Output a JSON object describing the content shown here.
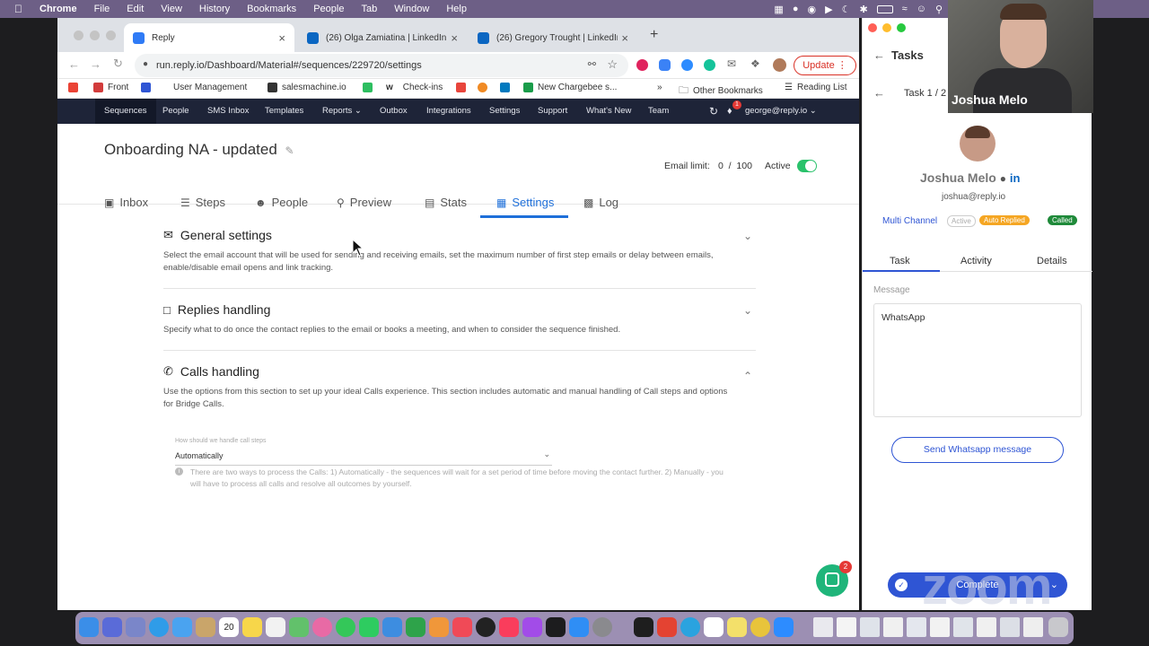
{
  "menubar": {
    "items": [
      "Chrome",
      "File",
      "Edit",
      "View",
      "History",
      "Bookmarks",
      "People",
      "Tab",
      "Window",
      "Help"
    ]
  },
  "browser": {
    "tabs": [
      {
        "title": "Reply",
        "color": "#2f7bf6"
      },
      {
        "title": "(26) Olga Zamiatina | LinkedIn",
        "color": "#0a66c2"
      },
      {
        "title": "(26) Gregory Trought | LinkedIn",
        "color": "#0a66c2"
      }
    ],
    "new_tab": "+",
    "url": "run.reply.io/Dashboard/Material#/sequences/229720/settings",
    "update_label": "Update",
    "bookmarks": [
      "Front",
      "User Management",
      "salesmachine.io",
      "Check-ins",
      "New Chargebee s...",
      "Other Bookmarks",
      "Reading List"
    ],
    "bookmarks_more": "»"
  },
  "appnav": {
    "items": [
      "Sequences",
      "People",
      "SMS Inbox",
      "Templates",
      "Reports",
      "Outbox",
      "Integrations",
      "Settings",
      "Support",
      "What's New",
      "Team"
    ],
    "user": "george@reply.io",
    "notif_count": "1"
  },
  "sequence": {
    "title": "Onboarding NA - updated",
    "email_limit_label": "Email limit:",
    "email_limit_value": "0  /  100",
    "status": "Active",
    "tabs": [
      "Inbox",
      "Steps",
      "People",
      "Preview",
      "Stats",
      "Settings",
      "Log"
    ]
  },
  "settings": {
    "sections": [
      {
        "title": "General settings",
        "desc": "Select the email account that will be used for sending and receiving emails, set the maximum number of first step emails or delay between emails, enable/disable email opens and link tracking."
      },
      {
        "title": "Replies handling",
        "desc": "Specify what to do once the contact replies to the email or books a meeting, and when to consider the sequence finished."
      },
      {
        "title": "Calls handling",
        "desc": "Use the options from this section to set up your ideal Calls experience. This section includes automatic and manual handling of Call steps and options for Bridge Calls."
      }
    ],
    "call_question": "How should we handle call steps",
    "call_value": "Automatically",
    "call_hint": "There are two ways to process the Calls: 1) Automatically - the sequences will wait for a set period of time before moving the contact further. 2) Manually - you will have to process all calls and resolve all outcomes by yourself.",
    "chat_badge": "2"
  },
  "tasks": {
    "title": "Tasks",
    "counter": "Task 1 / 2",
    "contact_name": "Joshua Melo",
    "contact_email": "joshua@reply.io",
    "channel_label": "Multi Channel",
    "badges": [
      {
        "text": "Active",
        "color": "#bbbbbb"
      },
      {
        "text": "Auto Replied",
        "color": "#f5a623"
      },
      {
        "text": "Called",
        "color": "#1f8a3a"
      }
    ],
    "tabs": [
      "Task",
      "Activity",
      "Details"
    ],
    "message_label": "Message",
    "message_text": "WhatsApp",
    "send_button": "Send Whatsapp message",
    "complete_button": "Complete"
  },
  "zoom": {
    "participant": "Joshua Melo",
    "watermark": "zoom"
  },
  "dock": {
    "calendar_day": "20"
  }
}
